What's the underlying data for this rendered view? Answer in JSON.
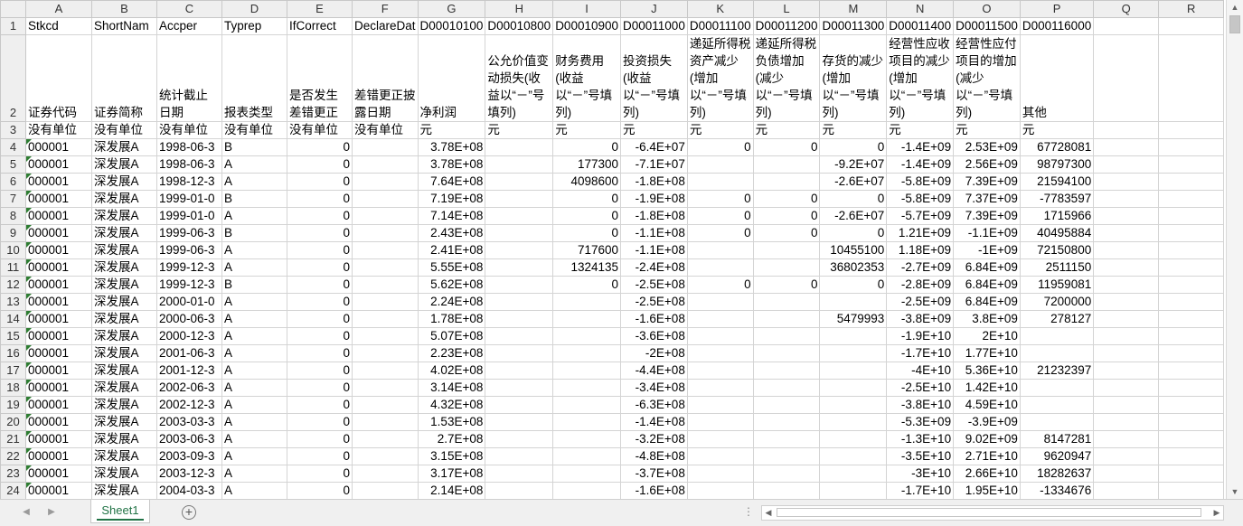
{
  "columns": [
    "A",
    "B",
    "C",
    "D",
    "E",
    "F",
    "G",
    "H",
    "I",
    "J",
    "K",
    "L",
    "M",
    "N",
    "O",
    "P",
    "Q",
    "R"
  ],
  "row_numbers": [
    "1",
    "2",
    "3",
    "4",
    "5",
    "6",
    "7",
    "8",
    "9",
    "10",
    "11",
    "12",
    "13",
    "14",
    "15",
    "16",
    "17",
    "18",
    "19",
    "20",
    "21",
    "22",
    "23",
    "24"
  ],
  "row1": [
    "Stkcd",
    "ShortNam",
    "Accper",
    "Typrep",
    "IfCorrect",
    "DeclareDat",
    "D00010100",
    "D00010800",
    "D00010900",
    "D00011000",
    "D00011100",
    "D00011200",
    "D00011300",
    "D00011400",
    "D00011500",
    "D000116000",
    "",
    ""
  ],
  "row2": [
    "证券代码",
    "证券简称",
    "统计截止日期",
    "报表类型",
    "是否发生差错更正",
    "差错更正披露日期",
    "净利润",
    "公允价值变动损失(收益以“－”号填列)",
    "财务费用(收益以“－”号填列)",
    "投资损失(收益以“－”号填列)",
    "递延所得税资产减少(增加以“－”号填列)",
    "递延所得税负债增加(减少以“－”号填列)",
    "存货的减少(增加以“－”号填列)",
    "经营性应收项目的减少(增加以“－”号填列)",
    "经营性应付项目的增加(减少以“－”号填列)",
    "其他",
    "",
    ""
  ],
  "row3": [
    "没有单位",
    "没有单位",
    "没有单位",
    "没有单位",
    "没有单位",
    "没有单位",
    "元",
    "元",
    "元",
    "元",
    "元",
    "元",
    "元",
    "元",
    "元",
    "元",
    "",
    ""
  ],
  "data_rows": [
    [
      "000001",
      "深发展A",
      "1998-06-3",
      "B",
      "0",
      "",
      "3.78E+08",
      "",
      "0",
      "-6.4E+07",
      "0",
      "0",
      "0",
      "-1.4E+09",
      "2.53E+09",
      "67728081",
      "",
      ""
    ],
    [
      "000001",
      "深发展A",
      "1998-06-3",
      "A",
      "0",
      "",
      "3.78E+08",
      "",
      "177300",
      "-7.1E+07",
      "",
      "",
      "-9.2E+07",
      "-1.4E+09",
      "2.56E+09",
      "98797300",
      "",
      ""
    ],
    [
      "000001",
      "深发展A",
      "1998-12-3",
      "A",
      "0",
      "",
      "7.64E+08",
      "",
      "4098600",
      "-1.8E+08",
      "",
      "",
      "-2.6E+07",
      "-5.8E+09",
      "7.39E+09",
      "21594100",
      "",
      ""
    ],
    [
      "000001",
      "深发展A",
      "1999-01-0",
      "B",
      "0",
      "",
      "7.19E+08",
      "",
      "0",
      "-1.9E+08",
      "0",
      "0",
      "0",
      "-5.8E+09",
      "7.37E+09",
      "-7783597",
      "",
      ""
    ],
    [
      "000001",
      "深发展A",
      "1999-01-0",
      "A",
      "0",
      "",
      "7.14E+08",
      "",
      "0",
      "-1.8E+08",
      "0",
      "0",
      "-2.6E+07",
      "-5.7E+09",
      "7.39E+09",
      "1715966",
      "",
      ""
    ],
    [
      "000001",
      "深发展A",
      "1999-06-3",
      "B",
      "0",
      "",
      "2.43E+08",
      "",
      "0",
      "-1.1E+08",
      "0",
      "0",
      "0",
      "1.21E+09",
      "-1.1E+09",
      "40495884",
      "",
      ""
    ],
    [
      "000001",
      "深发展A",
      "1999-06-3",
      "A",
      "0",
      "",
      "2.41E+08",
      "",
      "717600",
      "-1.1E+08",
      "",
      "",
      "10455100",
      "1.18E+09",
      "-1E+09",
      "72150800",
      "",
      ""
    ],
    [
      "000001",
      "深发展A",
      "1999-12-3",
      "A",
      "0",
      "",
      "5.55E+08",
      "",
      "1324135",
      "-2.4E+08",
      "",
      "",
      "36802353",
      "-2.7E+09",
      "6.84E+09",
      "2511150",
      "",
      ""
    ],
    [
      "000001",
      "深发展A",
      "1999-12-3",
      "B",
      "0",
      "",
      "5.62E+08",
      "",
      "0",
      "-2.5E+08",
      "0",
      "0",
      "0",
      "-2.8E+09",
      "6.84E+09",
      "11959081",
      "",
      ""
    ],
    [
      "000001",
      "深发展A",
      "2000-01-0",
      "A",
      "0",
      "",
      "2.24E+08",
      "",
      "",
      "-2.5E+08",
      "",
      "",
      "",
      "-2.5E+09",
      "6.84E+09",
      "7200000",
      "",
      ""
    ],
    [
      "000001",
      "深发展A",
      "2000-06-3",
      "A",
      "0",
      "",
      "1.78E+08",
      "",
      "",
      "-1.6E+08",
      "",
      "",
      "5479993",
      "-3.8E+09",
      "3.8E+09",
      "278127",
      "",
      ""
    ],
    [
      "000001",
      "深发展A",
      "2000-12-3",
      "A",
      "0",
      "",
      "5.07E+08",
      "",
      "",
      "-3.6E+08",
      "",
      "",
      "",
      "-1.9E+10",
      "2E+10",
      "",
      "",
      ""
    ],
    [
      "000001",
      "深发展A",
      "2001-06-3",
      "A",
      "0",
      "",
      "2.23E+08",
      "",
      "",
      "-2E+08",
      "",
      "",
      "",
      "-1.7E+10",
      "1.77E+10",
      "",
      "",
      ""
    ],
    [
      "000001",
      "深发展A",
      "2001-12-3",
      "A",
      "0",
      "",
      "4.02E+08",
      "",
      "",
      "-4.4E+08",
      "",
      "",
      "",
      "-4E+10",
      "5.36E+10",
      "21232397",
      "",
      ""
    ],
    [
      "000001",
      "深发展A",
      "2002-06-3",
      "A",
      "0",
      "",
      "3.14E+08",
      "",
      "",
      "-3.4E+08",
      "",
      "",
      "",
      "-2.5E+10",
      "1.42E+10",
      "",
      "",
      ""
    ],
    [
      "000001",
      "深发展A",
      "2002-12-3",
      "A",
      "0",
      "",
      "4.32E+08",
      "",
      "",
      "-6.3E+08",
      "",
      "",
      "",
      "-3.8E+10",
      "4.59E+10",
      "",
      "",
      ""
    ],
    [
      "000001",
      "深发展A",
      "2003-03-3",
      "A",
      "0",
      "",
      "1.53E+08",
      "",
      "",
      "-1.4E+08",
      "",
      "",
      "",
      "-5.3E+09",
      "-3.9E+09",
      "",
      "",
      ""
    ],
    [
      "000001",
      "深发展A",
      "2003-06-3",
      "A",
      "0",
      "",
      "2.7E+08",
      "",
      "",
      "-3.2E+08",
      "",
      "",
      "",
      "-1.3E+10",
      "9.02E+09",
      "8147281",
      "",
      ""
    ],
    [
      "000001",
      "深发展A",
      "2003-09-3",
      "A",
      "0",
      "",
      "3.15E+08",
      "",
      "",
      "-4.8E+08",
      "",
      "",
      "",
      "-3.5E+10",
      "2.71E+10",
      "9620947",
      "",
      ""
    ],
    [
      "000001",
      "深发展A",
      "2003-12-3",
      "A",
      "0",
      "",
      "3.17E+08",
      "",
      "",
      "-3.7E+08",
      "",
      "",
      "",
      "-3E+10",
      "2.66E+10",
      "18282637",
      "",
      ""
    ],
    [
      "000001",
      "深发展A",
      "2004-03-3",
      "A",
      "0",
      "",
      "2.14E+08",
      "",
      "",
      "-1.6E+08",
      "",
      "",
      "",
      "-1.7E+10",
      "1.95E+10",
      "-1334676",
      "",
      ""
    ]
  ],
  "sheet_tab": "Sheet1",
  "add_sheet_symbol": "+",
  "nav_prev": "◀",
  "nav_next": "▶",
  "scroll_up": "▲",
  "scroll_down": "▼",
  "scroll_left": "◀",
  "scroll_right": "▶",
  "dots": "⋮"
}
